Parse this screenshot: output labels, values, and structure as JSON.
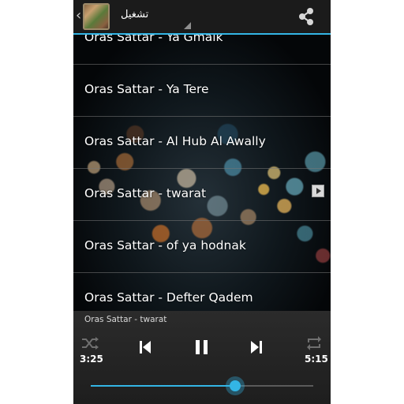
{
  "action_bar": {
    "title": "تشغيل",
    "up_icon": "chevron-left-icon",
    "app_icon": "app-thumbnail-icon",
    "share_icon": "share-icon"
  },
  "songs": [
    {
      "title": "Oras Sattar - Ya Gmalk"
    },
    {
      "title": "Oras Sattar - Ya Tere"
    },
    {
      "title": "Oras Sattar - Al Hub Al Awally"
    },
    {
      "title": "Oras Sattar - twarat",
      "playing": true
    },
    {
      "title": "Oras Sattar - of ya hodnak"
    },
    {
      "title": "Oras Sattar - Defter Qadem"
    }
  ],
  "player": {
    "now_playing": "Oras Sattar - twarat",
    "elapsed": "3:25",
    "duration": "5:15",
    "progress_fraction": 0.65,
    "controls": [
      "shuffle-icon",
      "previous-icon",
      "pause-icon",
      "next-icon",
      "repeat-icon"
    ]
  },
  "colors": {
    "accent": "#33b5e5",
    "action_bar_bg": "#1b1b1b",
    "player_bg": "#2b2b2b"
  }
}
